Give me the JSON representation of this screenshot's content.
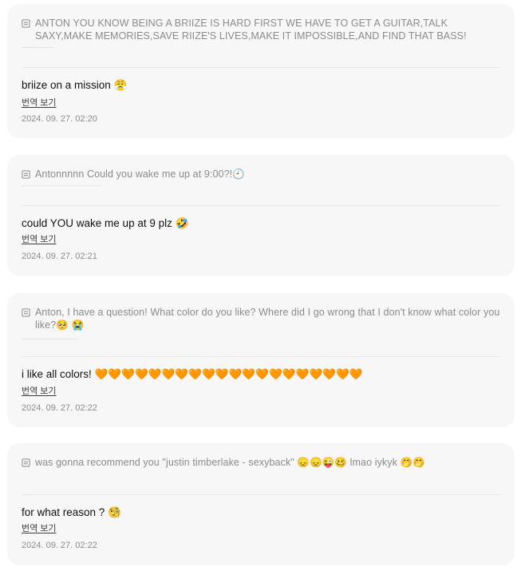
{
  "messages": [
    {
      "quote": "ANTON YOU KNOW BEING A BRIIZE IS HARD FIRST WE HAVE TO GET A GUITAR,TALK SAXY,MAKE MEMORIES,SAVE RIIZE'S LIVES,MAKE IT IMPOSSIBLE,AND FIND THAT BASS!",
      "reply": "briize on a mission 😤",
      "translate_label": "번역 보기",
      "timestamp": "2024. 09. 27. 02:20"
    },
    {
      "quote": "Antonnnnn Could you wake me up at 9:00?!🕘",
      "reply": "could YOU wake me up at 9 plz 🤣",
      "translate_label": "번역 보기",
      "timestamp": "2024. 09. 27. 02:21"
    },
    {
      "quote": "Anton, I have a question! What color do you like? Where did I go wrong that I don't know what color you like?🥺 😭",
      "reply": "i like all colors! 🧡🧡🧡🧡🧡🧡🧡🧡🧡🧡🧡🧡🧡🧡🧡🧡🧡🧡🧡🧡",
      "translate_label": "번역 보기",
      "timestamp": "2024. 09. 27. 02:22"
    },
    {
      "quote": "was gonna recommend you \"justin timberlake - sexyback\" 😞😞😜🥴 lmao iykyk 🤭🤭",
      "reply": "for what reason ? 🧐",
      "translate_label": "번역 보기",
      "timestamp": "2024. 09. 27. 02:22"
    }
  ]
}
